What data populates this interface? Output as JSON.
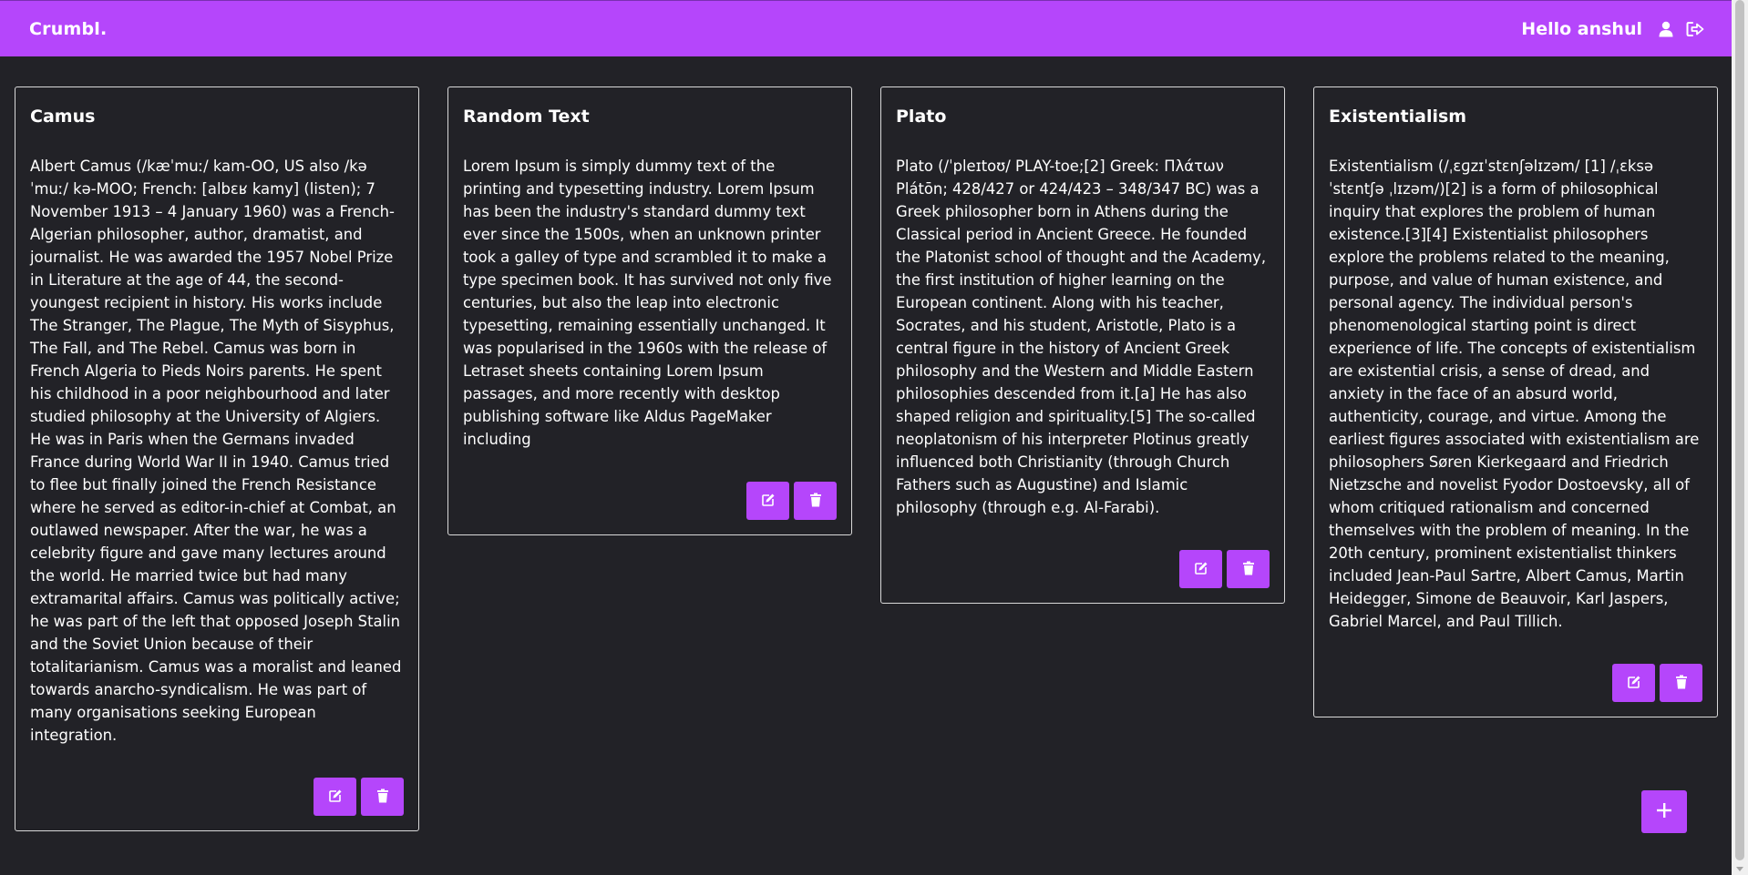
{
  "navbar": {
    "brand": "Crumbl.",
    "greeting": "Hello anshul",
    "icons": [
      "user-icon",
      "logout-icon"
    ]
  },
  "notes": [
    {
      "title": "Camus",
      "body": "Albert Camus (/kæˈmuː/ kam-OO, US also /kə ˈmuː/ kə-MOO; French: [albɛʁ kamy] (listen); 7 November 1913 – 4 January 1960) was a French-Algerian philosopher, author, dramatist, and journalist. He was awarded the 1957 Nobel Prize in Literature at the age of 44, the second-youngest recipient in history. His works include The Stranger, The Plague, The Myth of Sisyphus, The Fall, and The Rebel. Camus was born in French Algeria to Pieds Noirs parents. He spent his childhood in a poor neighbourhood and later studied philosophy at the University of Algiers. He was in Paris when the Germans invaded France during World War II in 1940. Camus tried to flee but finally joined the French Resistance where he served as editor-in-chief at Combat, an outlawed newspaper. After the war, he was a celebrity figure and gave many lectures around the world. He married twice but had many extramarital affairs. Camus was politically active; he was part of the left that opposed Joseph Stalin and the Soviet Union because of their totalitarianism. Camus was a moralist and leaned towards anarcho-syndicalism. He was part of many organisations seeking European integration."
    },
    {
      "title": "Random Text",
      "body": "Lorem Ipsum is simply dummy text of the printing and typesetting industry. Lorem Ipsum has been the industry's standard dummy text ever since the 1500s, when an unknown printer took a galley of type and scrambled it to make a type specimen book. It has survived not only five centuries, but also the leap into electronic typesetting, remaining essentially unchanged. It was popularised in the 1960s with the release of Letraset sheets containing Lorem Ipsum passages, and more recently with desktop publishing software like Aldus PageMaker including"
    },
    {
      "title": "Plato",
      "body": "Plato (/ˈpleɪtoʊ/ PLAY-toe;[2] Greek: Πλάτων Plátōn; 428/427 or 424/423 – 348/347 BC) was a Greek philosopher born in Athens during the Classical period in Ancient Greece. He founded the Platonist school of thought and the Academy, the first institution of higher learning on the European continent. Along with his teacher, Socrates, and his student, Aristotle, Plato is a central figure in the history of Ancient Greek philosophy and the Western and Middle Eastern philosophies descended from it.[a] He has also shaped religion and spirituality.[5] The so-called neoplatonism of his interpreter Plotinus greatly influenced both Christianity (through Church Fathers such as Augustine) and Islamic philosophy (through e.g. Al-Farabi)."
    },
    {
      "title": "Existentialism",
      "body": "Existentialism (/ˌɛɡzɪˈstɛnʃəlɪzəm/ [1] /ˌɛksəˈstɛntʃə ˌlɪzəm/)[2] is a form of philosophical inquiry that explores the problem of human existence.[3][4] Existentialist philosophers explore the problems related to the meaning, purpose, and value of human existence, and personal agency. The individual person's phenomenological starting point is direct experience of life. The concepts of existentialism are existential crisis, a sense of dread, and anxiety in the face of an absurd world, authenticity, courage, and virtue. Among the earliest figures associated with existentialism are philosophers Søren Kierkegaard and Friedrich Nietzsche and novelist Fyodor Dostoevsky, all of whom critiqued rationalism and concerned themselves with the problem of meaning. In the 20th century, prominent existentialist thinkers included Jean-Paul Sartre, Albert Camus, Martin Heidegger, Simone de Beauvoir, Karl Jaspers, Gabriel Marcel, and Paul Tillich."
    }
  ],
  "actions": {
    "edit_icon": "edit-icon",
    "delete_icon": "trash-icon",
    "add_icon": "plus-icon"
  },
  "colors": {
    "accent": "#b546fb",
    "background": "#222227",
    "card_border": "#d9d9d9",
    "text": "#ffffff"
  }
}
